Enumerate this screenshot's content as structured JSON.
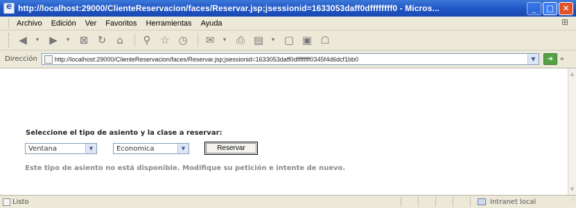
{
  "window": {
    "title": "http://localhost:29000/ClienteReservacion/faces/Reservar.jsp;jsessionid=1633053daff0dffffffff0 - Micros..."
  },
  "menu": [
    "Archivo",
    "Edición",
    "Ver",
    "Favoritos",
    "Herramientas",
    "Ayuda"
  ],
  "address": {
    "label": "Dirección",
    "url": "http://localhost:29000/ClienteReservacion/faces/Reservar.jsp;jsessionid=1633053daff0dffffffff0345f4d6dcf1bb0"
  },
  "form": {
    "heading": "Seleccione el tipo de asiento y la clase a reservar:",
    "seat_type": "Ventana",
    "seat_class": "Economica",
    "reserve_label": "Reservar",
    "message": "Este tipo de asiento no está disponible. Modifique su petición e intente de nuevo."
  },
  "status": {
    "text": "Listo",
    "zone": "Intranet local"
  },
  "colors": {
    "titlebar": "#1f54c4",
    "message": "#8a8a8a"
  }
}
